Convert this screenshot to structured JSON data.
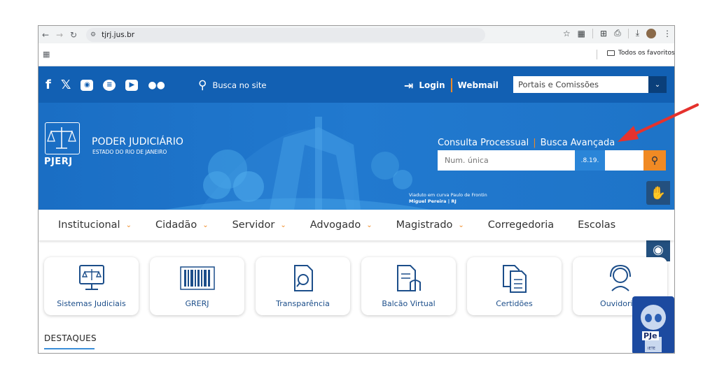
{
  "browser": {
    "url": "tjrj.jus.br",
    "bookmark_folder": "Todos os favoritos"
  },
  "topbar": {
    "search_label": "Busca no site",
    "login_label": "Login",
    "webmail_label": "Webmail",
    "portal_select_value": "Portais e Comissões"
  },
  "hero": {
    "logo_text": "PJERJ",
    "org_name": "PODER JUDICIÁRIO",
    "org_state": "ESTADO DO RIO DE JANEIRO",
    "consulta_label": "Consulta Processual",
    "busca_label": "Busca Avançada",
    "num_placeholder": "Num. única",
    "num_suffix": ".8.19.",
    "credit_line1": "Viaduto em curva Paulo de Frontin",
    "credit_line2": "Miguel Pereira | RJ"
  },
  "nav": {
    "items": [
      {
        "label": "Institucional"
      },
      {
        "label": "Cidadão"
      },
      {
        "label": "Servidor"
      },
      {
        "label": "Advogado"
      },
      {
        "label": "Magistrado"
      },
      {
        "label": "Corregedoria"
      },
      {
        "label": "Escolas"
      }
    ]
  },
  "cards": [
    {
      "label": "Sistemas Judiciais"
    },
    {
      "label": "GRERJ"
    },
    {
      "label": "Transparência"
    },
    {
      "label": "Balcão Virtual"
    },
    {
      "label": "Certidões"
    },
    {
      "label": "Ouvidoria/"
    }
  ],
  "section": {
    "destaques": "DESTAQUES"
  },
  "robot": {
    "badge": "PJe",
    "sub": "IETE"
  },
  "colors": {
    "brand_blue": "#1260b3",
    "accent_orange": "#f08a24",
    "annotation_red": "#e5322d"
  }
}
